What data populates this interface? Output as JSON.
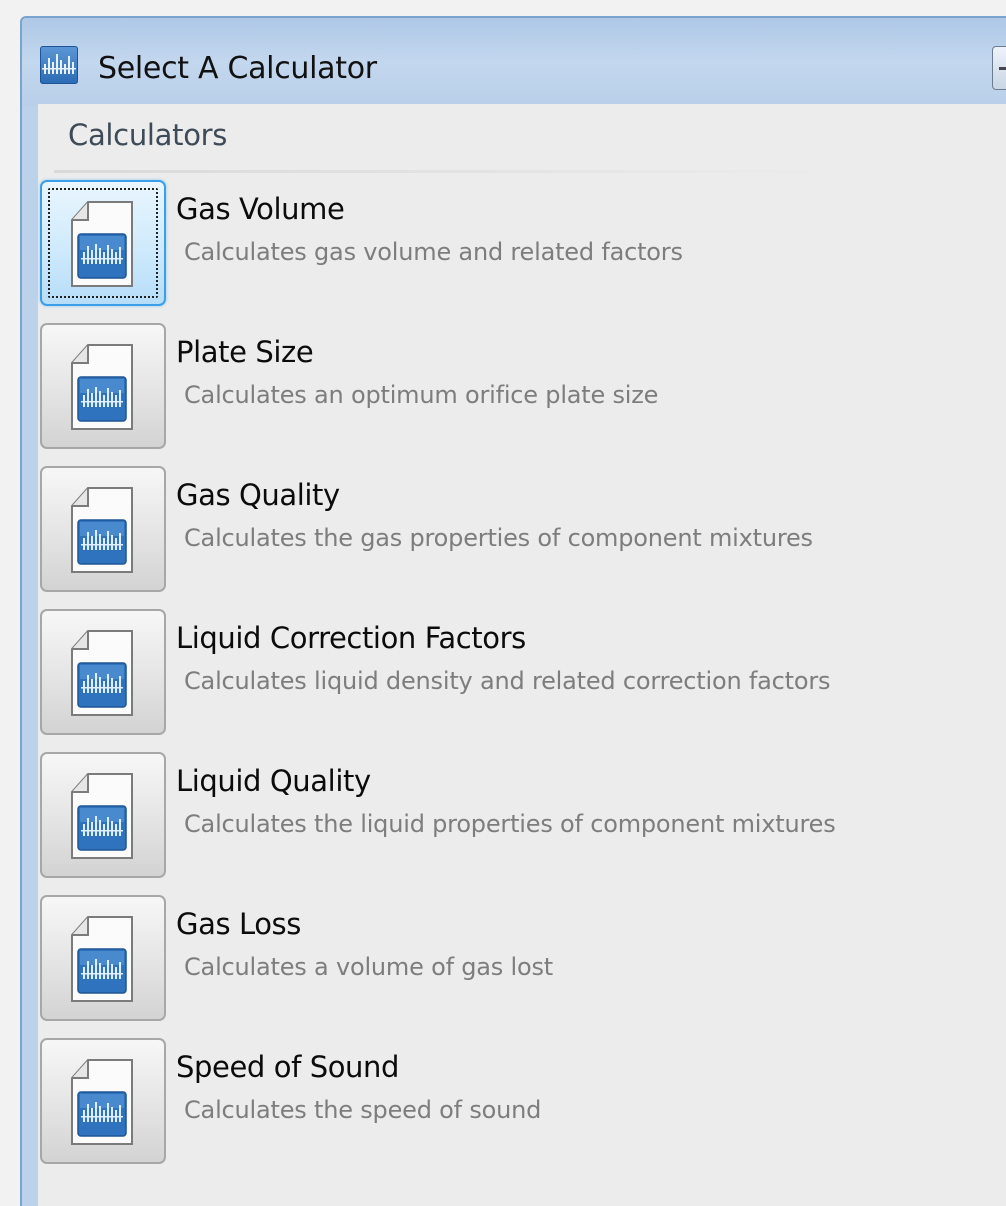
{
  "window": {
    "title": "Select A Calculator",
    "app_icon": "calculator-app-icon",
    "accent_color": "#3d9ee8"
  },
  "section": {
    "header": "Calculators"
  },
  "calculators": [
    {
      "title": "Gas Volume",
      "description": "Calculates gas volume and related factors",
      "selected": true,
      "icon": "calculator-document-icon"
    },
    {
      "title": "Plate Size",
      "description": "Calculates an optimum orifice plate size",
      "selected": false,
      "icon": "calculator-document-icon"
    },
    {
      "title": "Gas Quality",
      "description": "Calculates the gas properties of component mixtures",
      "selected": false,
      "icon": "calculator-document-icon"
    },
    {
      "title": "Liquid Correction Factors",
      "description": "Calculates liquid density and related correction factors",
      "selected": false,
      "icon": "calculator-document-icon"
    },
    {
      "title": "Liquid Quality",
      "description": "Calculates the liquid properties of component mixtures",
      "selected": false,
      "icon": "calculator-document-icon"
    },
    {
      "title": "Gas Loss",
      "description": "Calculates a volume of gas lost",
      "selected": false,
      "icon": "calculator-document-icon"
    },
    {
      "title": "Speed of Sound",
      "description": "Calculates the speed of sound",
      "selected": false,
      "icon": "calculator-document-icon"
    }
  ]
}
